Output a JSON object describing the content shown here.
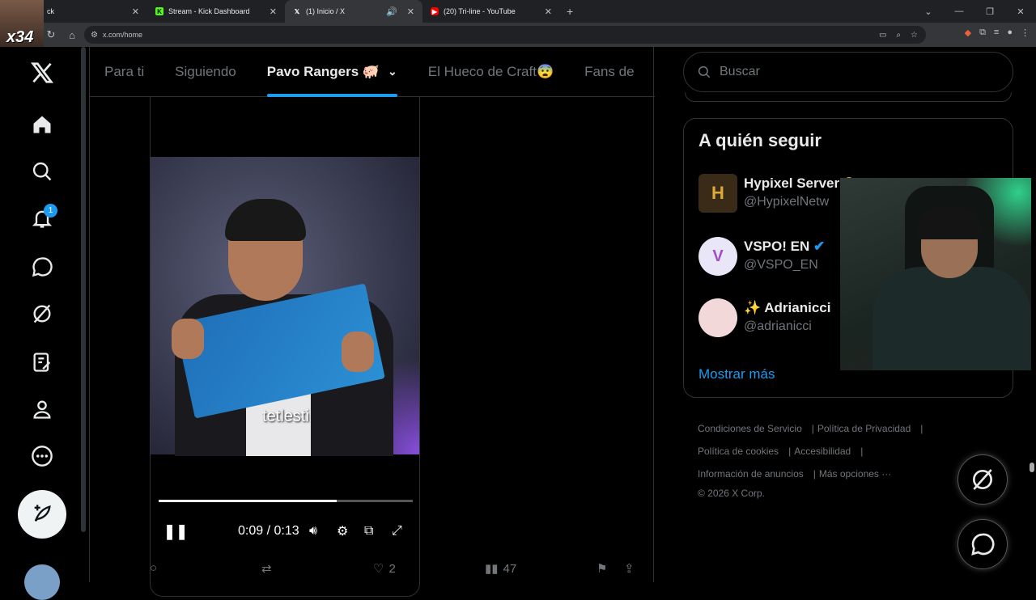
{
  "browser": {
    "tabs": [
      {
        "title": "ck",
        "active": false
      },
      {
        "title": "Stream - Kick Dashboard",
        "active": false
      },
      {
        "title": "(1) Inicio / X",
        "active": true
      },
      {
        "title": "(20) Tri-line - YouTube",
        "active": false
      }
    ],
    "new_tab": "+",
    "url": "x.com/home"
  },
  "overlay": {
    "badge_text": "x34"
  },
  "nav": {
    "notifications_count": "1",
    "items": [
      "x-logo",
      "home",
      "explore",
      "notifications",
      "messages",
      "grok",
      "lists",
      "profile",
      "more",
      "post"
    ]
  },
  "feed_tabs": [
    {
      "label": "Para ti",
      "active": false
    },
    {
      "label": "Siguiendo",
      "active": false
    },
    {
      "label": "Pavo Rangers 🐖",
      "active": true
    },
    {
      "label": "El Hueco de Craft😨",
      "active": false
    },
    {
      "label": "Fans de",
      "active": false
    }
  ],
  "video": {
    "caption": "tetlesti",
    "current_time": "0:09",
    "separator": "/",
    "duration": "0:13",
    "progress": 0.7
  },
  "post_actions": {
    "likes": "2",
    "views": "47"
  },
  "search": {
    "placeholder": "Buscar"
  },
  "who_to_follow": {
    "title": "A quién seguir",
    "accounts": [
      {
        "name": "Hypixel Server",
        "handle": "@HypixelNetw"
      },
      {
        "name": "VSPO! EN",
        "handle": "@VSPO_EN"
      },
      {
        "name": "✨ Adrianicci",
        "handle": "@adrianicci"
      }
    ],
    "show_more": "Mostrar más"
  },
  "footer": {
    "links": [
      "Condiciones de Servicio",
      "Política de Privacidad",
      "Política de cookies",
      "Accesibilidad",
      "Información de anuncios",
      "Más opciones ···"
    ],
    "copyright": "© 2026 X Corp."
  },
  "colors": {
    "accent": "#1d9bf0",
    "background": "#000000",
    "muted": "#71767b",
    "border": "#2f3336"
  }
}
